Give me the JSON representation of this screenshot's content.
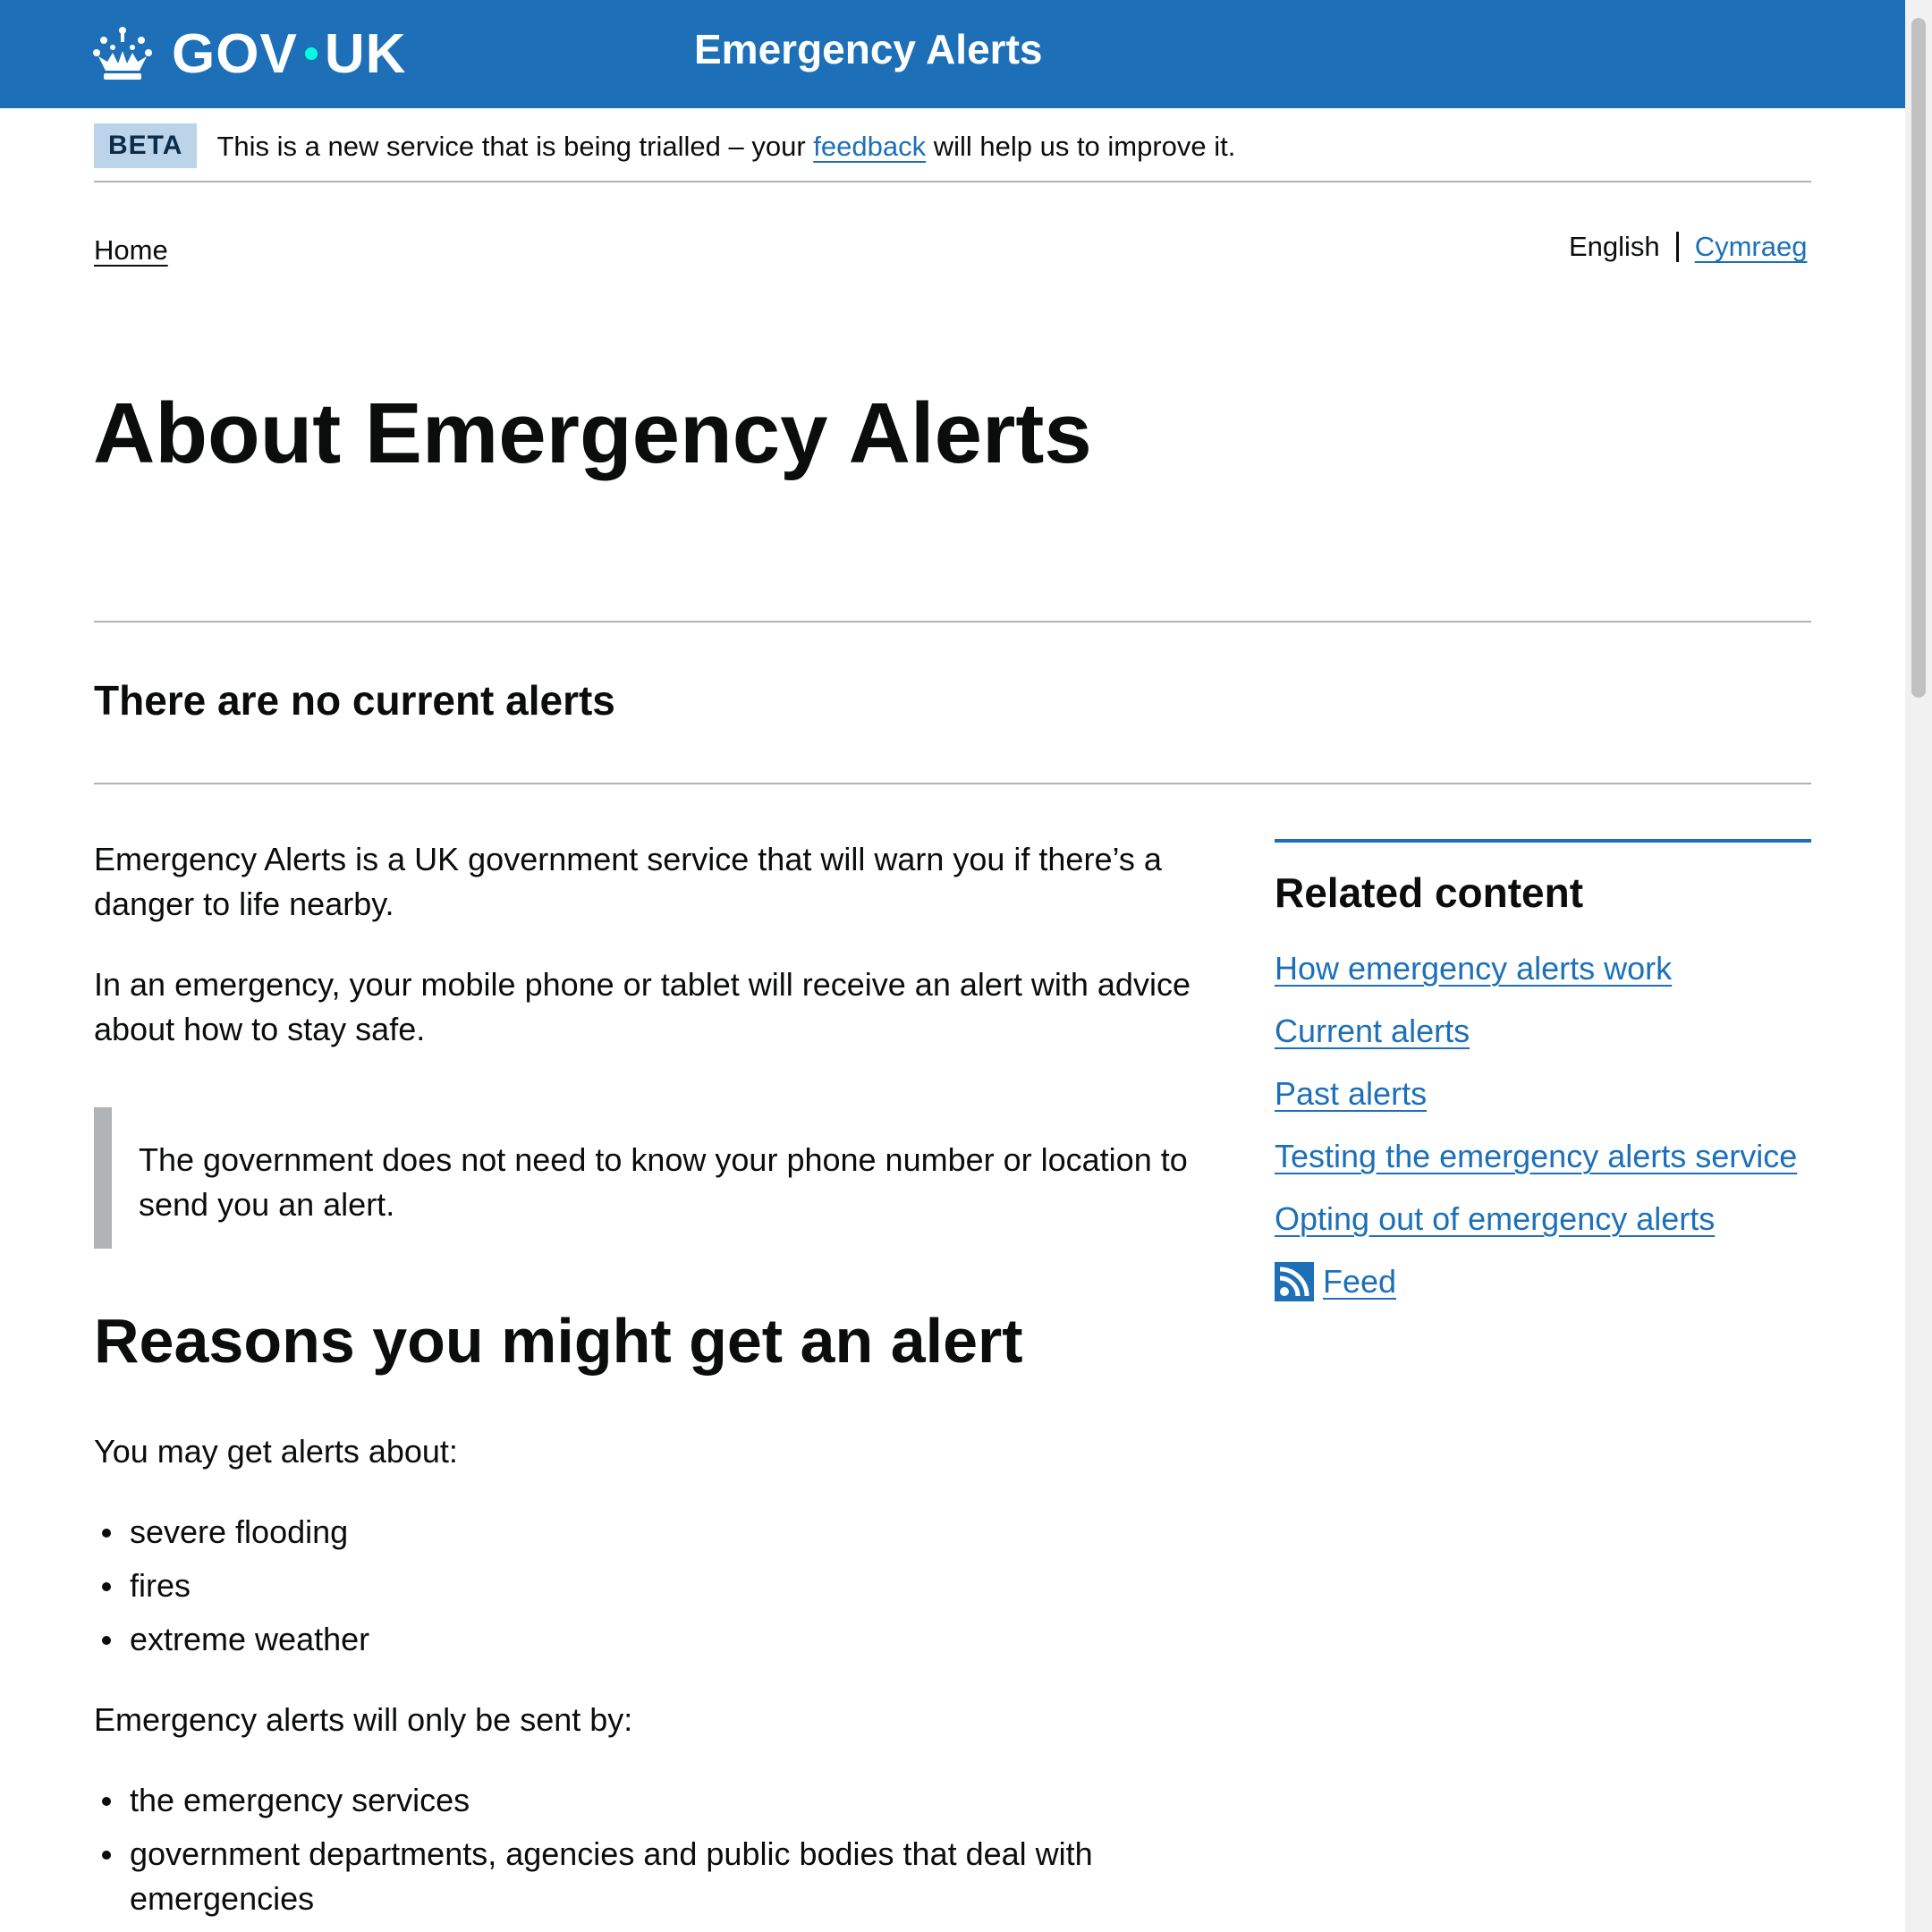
{
  "header": {
    "logo_text_left": "GOV",
    "logo_text_right": "UK",
    "service_name": "Emergency Alerts",
    "logo_icon": "crown-icon",
    "background_color": "#1d70b8"
  },
  "phase_banner": {
    "tag": "BETA",
    "text_before": "This is a new service that is being trialled – your ",
    "link": "feedback",
    "text_after": " will help us to improve it."
  },
  "breadcrumb": {
    "home": "Home"
  },
  "language": {
    "current": "English",
    "other": "Cymraeg"
  },
  "page_title": "About Emergency Alerts",
  "status": "There are no current alerts",
  "main": {
    "intro_p1": "Emergency Alerts is a UK government service that will warn you if there’s a danger to life nearby.",
    "intro_p2": "In an emergency, your mobile phone or tablet will receive an alert with advice about how to stay safe.",
    "inset": "The government does not need to know your phone number or location to send you an alert.",
    "reasons_heading": "Reasons you might get an alert",
    "reasons_intro": "You may get alerts about:",
    "reasons": [
      "severe flooding",
      "fires",
      "extreme weather"
    ],
    "senders_intro": "Emergency alerts will only be sent by:",
    "senders": [
      "the emergency services",
      "government departments, agencies and public bodies that deal with emergencies"
    ]
  },
  "related": {
    "heading": "Related content",
    "links": [
      "How emergency alerts work",
      "Current alerts",
      "Past alerts",
      "Testing the emergency alerts service",
      "Opting out of emergency alerts"
    ],
    "feed": "Feed",
    "feed_icon": "rss-icon"
  }
}
